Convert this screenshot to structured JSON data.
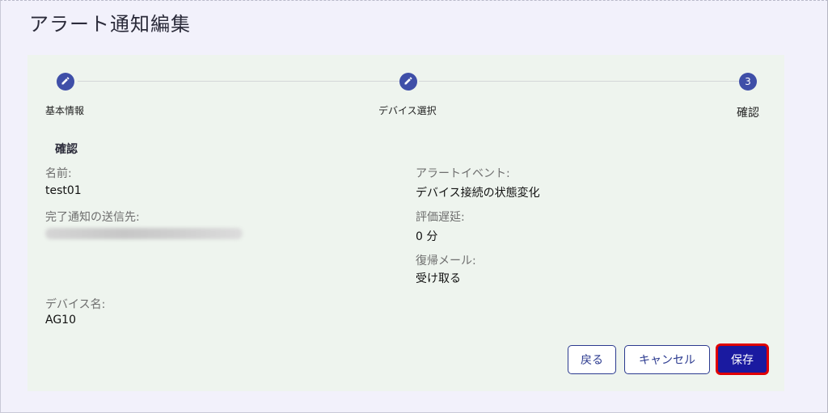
{
  "page": {
    "title": "アラート通知編集"
  },
  "stepper": {
    "steps": [
      {
        "label": "基本情報",
        "state": "done",
        "icon": "pencil-icon"
      },
      {
        "label": "デバイス選択",
        "state": "done",
        "icon": "pencil-icon"
      },
      {
        "label": "確認",
        "state": "active",
        "number": "3"
      }
    ]
  },
  "confirm": {
    "section_title": "確認",
    "left": {
      "name_label": "名前:",
      "name_value": "test01",
      "notify_label": "完了通知の送信先:",
      "device_label": "デバイス名:",
      "device_value": "AG10"
    },
    "right": {
      "event_label": "アラートイベント:",
      "event_value": "デバイス接続の状態変化",
      "delay_label": "評価遅延:",
      "delay_value": "0 分",
      "recovery_label": "復帰メール:",
      "recovery_value": "受け取る"
    }
  },
  "actions": {
    "back_label": "戻る",
    "cancel_label": "キャンセル",
    "save_label": "保存"
  },
  "colors": {
    "accent": "#3f4fa8",
    "primary_button": "#1a1aa0",
    "highlight_border": "#e00000"
  }
}
